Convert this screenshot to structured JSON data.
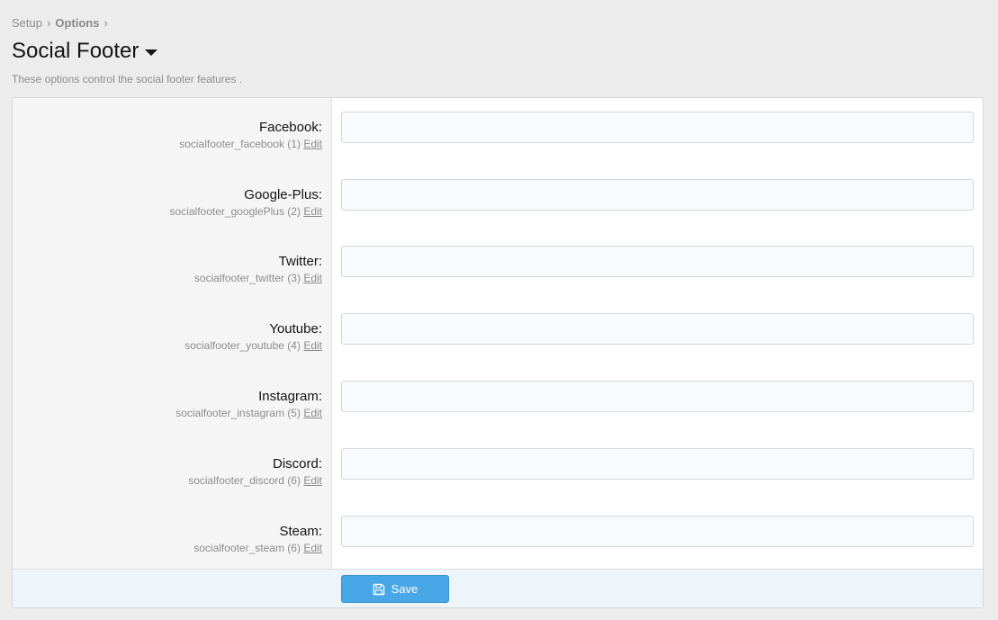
{
  "breadcrumb": [
    {
      "label": "Setup"
    },
    {
      "label": "Options"
    }
  ],
  "page": {
    "title": "Social Footer",
    "description": "These options control the social footer features ."
  },
  "options": [
    {
      "label": "Facebook:",
      "key": "socialfooter_facebook",
      "order": "(1)",
      "edit": "Edit",
      "value": ""
    },
    {
      "label": "Google-Plus:",
      "key": "socialfooter_googlePlus",
      "order": "(2)",
      "edit": "Edit",
      "value": ""
    },
    {
      "label": "Twitter:",
      "key": "socialfooter_twitter",
      "order": "(3)",
      "edit": "Edit",
      "value": ""
    },
    {
      "label": "Youtube:",
      "key": "socialfooter_youtube",
      "order": "(4)",
      "edit": "Edit",
      "value": ""
    },
    {
      "label": "Instagram:",
      "key": "socialfooter_instagram",
      "order": "(5)",
      "edit": "Edit",
      "value": ""
    },
    {
      "label": "Discord:",
      "key": "socialfooter_discord",
      "order": "(6)",
      "edit": "Edit",
      "value": ""
    },
    {
      "label": "Steam:",
      "key": "socialfooter_steam",
      "order": "(6)",
      "edit": "Edit",
      "value": ""
    }
  ],
  "footer": {
    "save_label": "Save",
    "save_icon": "floppy-disk-icon"
  },
  "colors": {
    "accent": "#48a7e7",
    "footer_bg": "#edf4fa",
    "label_bg": "#f5f5f5",
    "page_bg": "#ececec"
  }
}
